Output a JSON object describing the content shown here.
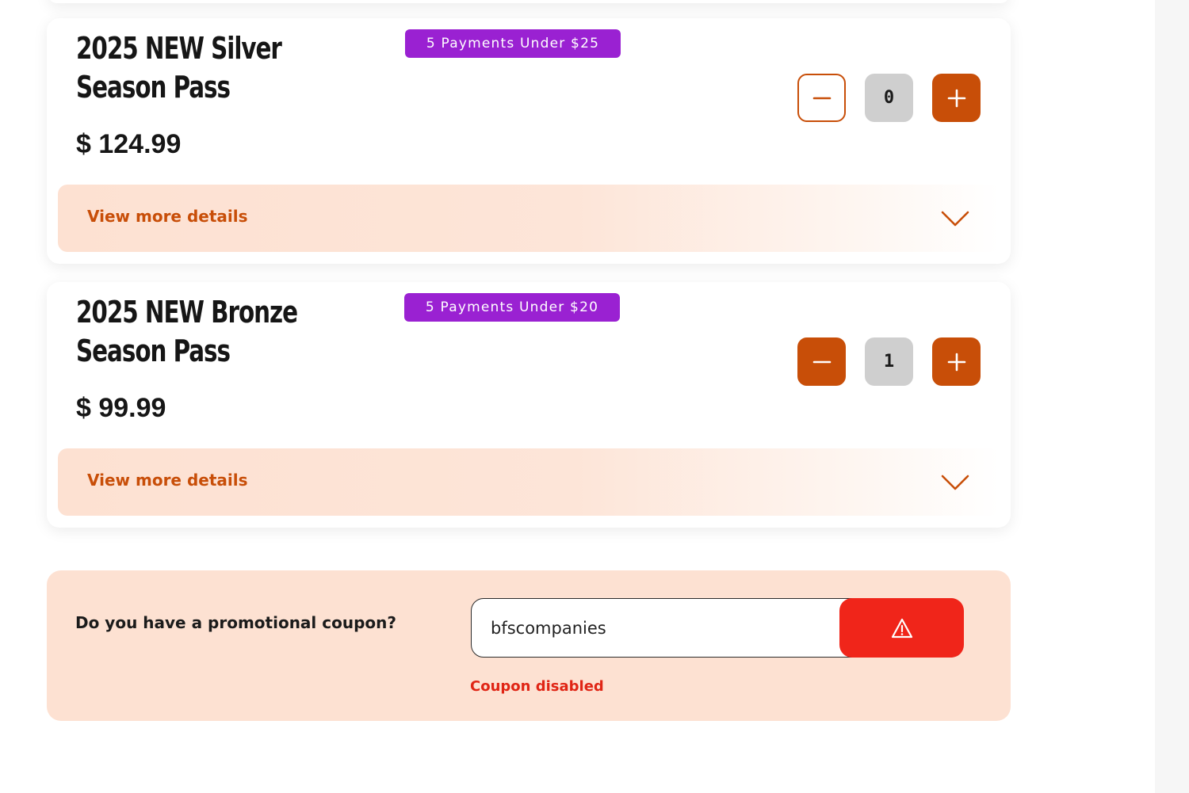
{
  "colors": {
    "accent": "#c84e08",
    "badge": "#9a21d2",
    "details_bg": "#fde1d2",
    "coupon_panel": "#fde1d2",
    "error": "#f0251a",
    "qty_bg": "#cfcfcf"
  },
  "products": [
    {
      "title": "2025 NEW Silver Season Pass",
      "price": "$ 124.99",
      "badge": "5 Payments Under $25",
      "quantity": "0",
      "minus_icon": "minus-icon",
      "plus_icon": "plus-icon",
      "details_label": "View more details",
      "details_icon": "chevron-down-icon"
    },
    {
      "title": "2025 NEW Bronze Season Pass",
      "price": "$ 99.99",
      "badge": "5 Payments Under $20",
      "quantity": "1",
      "minus_icon": "minus-icon",
      "plus_icon": "plus-icon",
      "details_label": "View more details",
      "details_icon": "chevron-down-icon"
    }
  ],
  "coupon": {
    "question": "Do you have a promotional coupon?",
    "value": "bfscompanies",
    "button_icon": "warning-icon",
    "error": "Coupon disabled"
  }
}
